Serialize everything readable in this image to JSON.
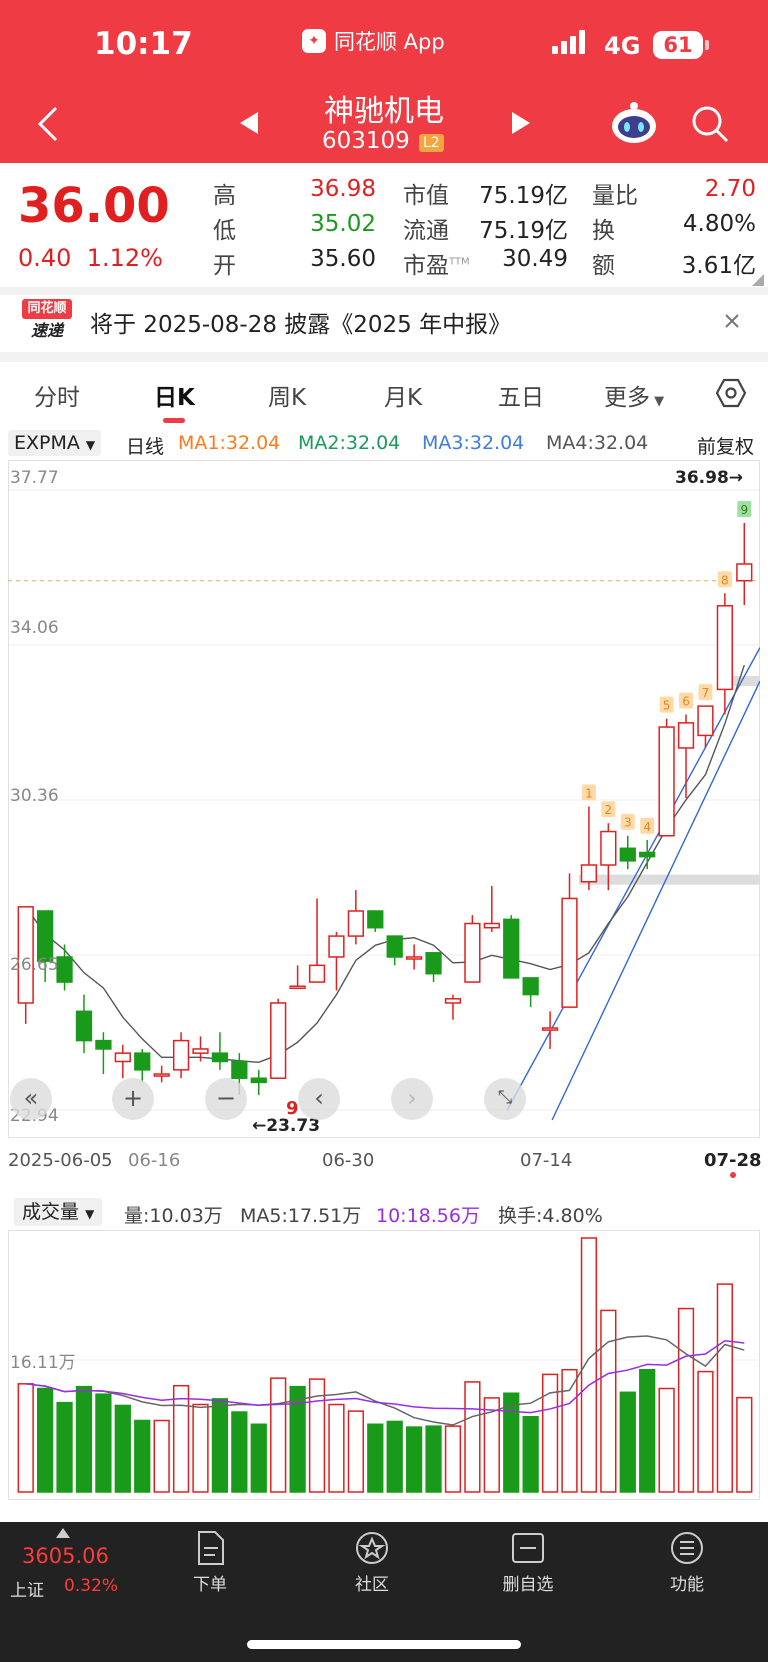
{
  "status": {
    "time": "10:17",
    "app": "同花顺 App",
    "network": "4G",
    "battery": "61"
  },
  "header": {
    "stock_name": "神驰机电",
    "stock_code": "603109",
    "level": "L2"
  },
  "quote": {
    "price": "36.00",
    "change": "0.40",
    "change_pct": "1.12%",
    "high_label": "高",
    "high": "36.98",
    "low_label": "低",
    "low": "35.02",
    "open_label": "开",
    "open": "35.60",
    "mktcap_label": "市值",
    "mktcap": "75.19亿",
    "float_label": "流通",
    "float": "75.19亿",
    "pe_label": "市盈",
    "pe_sup": "TTM",
    "pe": "30.49",
    "vr_label": "量比",
    "vr": "2.70",
    "turn_label": "换",
    "turn": "4.80%",
    "amt_label": "额",
    "amt": "3.61亿"
  },
  "notice": {
    "logo_top": "同花顺",
    "logo_bottom": "速递",
    "text": "将于 2025-08-28 披露《2025 年中报》"
  },
  "tabs": [
    "分时",
    "日K",
    "周K",
    "月K",
    "五日",
    "更多"
  ],
  "ma": {
    "indicator": "EXPMA",
    "period": "日线",
    "ma1": "MA1:32.04",
    "ma2": "MA2:32.04",
    "ma3": "MA3:32.04",
    "ma4": "MA4:32.04",
    "adjust": "前复权"
  },
  "price_axis": [
    "37.77",
    "34.06",
    "30.36",
    "26.65",
    "22.94"
  ],
  "annotations": {
    "high": "36.98→",
    "low": "←23.73",
    "low_mark": "9"
  },
  "dates": [
    "2025-06-05",
    "06-16",
    "06-30",
    "07-14",
    "07-28"
  ],
  "volume": {
    "indicator": "成交量",
    "vol": "量:10.03万",
    "ma5": "MA5:17.51万",
    "ma10": "10:18.56万",
    "turnover": "换手:4.80%",
    "axis": "16.11万"
  },
  "bottom_nav": {
    "index_value": "3605.06",
    "index_name": "上证",
    "index_pct": "0.32%",
    "items": [
      "下单",
      "社区",
      "删自选",
      "功能"
    ]
  },
  "colors": {
    "brand": "#ef3b44",
    "up": "#e02020",
    "down": "#1a9a1a"
  },
  "chart_data": {
    "type": "candlestick",
    "ylim": [
      22.94,
      37.77
    ],
    "candles": [
      {
        "o": 25.5,
        "c": 27.8,
        "h": 27.8,
        "l": 25.0
      },
      {
        "o": 27.7,
        "c": 26.5,
        "h": 27.7,
        "l": 26.0
      },
      {
        "o": 26.6,
        "c": 26.0,
        "h": 26.9,
        "l": 25.8
      },
      {
        "o": 25.3,
        "c": 24.6,
        "h": 25.7,
        "l": 24.3
      },
      {
        "o": 24.6,
        "c": 24.4,
        "h": 24.8,
        "l": 23.8
      },
      {
        "o": 24.1,
        "c": 24.3,
        "h": 24.5,
        "l": 23.7
      },
      {
        "o": 24.3,
        "c": 23.9,
        "h": 24.4,
        "l": 23.6
      },
      {
        "o": 23.8,
        "c": 23.8,
        "h": 24.0,
        "l": 23.6
      },
      {
        "o": 23.9,
        "c": 24.6,
        "h": 24.8,
        "l": 23.7
      },
      {
        "o": 24.3,
        "c": 24.4,
        "h": 24.7,
        "l": 24.1
      },
      {
        "o": 24.3,
        "c": 24.1,
        "h": 24.8,
        "l": 23.9
      },
      {
        "o": 24.1,
        "c": 23.7,
        "h": 24.3,
        "l": 23.3
      },
      {
        "o": 23.7,
        "c": 23.6,
        "h": 23.9,
        "l": 23.3
      },
      {
        "o": 23.7,
        "c": 25.5,
        "h": 25.6,
        "l": 23.73
      },
      {
        "o": 25.9,
        "c": 25.9,
        "h": 26.4,
        "l": 25.9
      },
      {
        "o": 26.0,
        "c": 26.4,
        "h": 28.0,
        "l": 26.0
      },
      {
        "o": 26.6,
        "c": 27.1,
        "h": 27.2,
        "l": 25.8
      },
      {
        "o": 27.1,
        "c": 27.7,
        "h": 28.2,
        "l": 26.9
      },
      {
        "o": 27.7,
        "c": 27.3,
        "h": 27.7,
        "l": 27.2
      },
      {
        "o": 27.1,
        "c": 26.6,
        "h": 27.1,
        "l": 26.4
      },
      {
        "o": 26.6,
        "c": 26.6,
        "h": 26.9,
        "l": 26.3
      },
      {
        "o": 26.7,
        "c": 26.2,
        "h": 26.7,
        "l": 26.0
      },
      {
        "o": 25.5,
        "c": 25.6,
        "h": 25.7,
        "l": 25.1
      },
      {
        "o": 26.0,
        "c": 27.4,
        "h": 27.6,
        "l": 26.0
      },
      {
        "o": 27.3,
        "c": 27.4,
        "h": 28.3,
        "l": 27.2
      },
      {
        "o": 27.5,
        "c": 26.1,
        "h": 27.6,
        "l": 26.1
      },
      {
        "o": 26.1,
        "c": 25.7,
        "h": 26.1,
        "l": 25.4
      },
      {
        "o": 24.9,
        "c": 24.9,
        "h": 25.3,
        "l": 24.4
      },
      {
        "o": 25.4,
        "c": 28.0,
        "h": 28.6,
        "l": 25.4
      },
      {
        "o": 28.4,
        "c": 28.8,
        "h": 30.2,
        "l": 28.2
      },
      {
        "o": 28.8,
        "c": 29.6,
        "h": 29.8,
        "l": 28.2
      },
      {
        "o": 29.2,
        "c": 28.9,
        "h": 29.5,
        "l": 28.7
      },
      {
        "o": 29.1,
        "c": 29.0,
        "h": 29.4,
        "l": 28.7
      },
      {
        "o": 29.5,
        "c": 32.1,
        "h": 32.3,
        "l": 29.5
      },
      {
        "o": 31.6,
        "c": 32.2,
        "h": 32.4,
        "l": 30.4
      },
      {
        "o": 31.9,
        "c": 32.6,
        "h": 32.6,
        "l": 31.6
      },
      {
        "o": 33.0,
        "c": 35.0,
        "h": 35.3,
        "l": 32.4
      },
      {
        "o": 35.6,
        "c": 36.0,
        "h": 36.98,
        "l": 35.02
      }
    ],
    "volume_max": 27.0,
    "volumes": [
      {
        "v": 11.5,
        "up": true
      },
      {
        "v": 11.0,
        "up": false
      },
      {
        "v": 9.5,
        "up": false
      },
      {
        "v": 11.2,
        "up": false
      },
      {
        "v": 10.4,
        "up": false
      },
      {
        "v": 9.2,
        "up": false
      },
      {
        "v": 7.6,
        "up": false
      },
      {
        "v": 7.6,
        "up": true
      },
      {
        "v": 11.3,
        "up": true
      },
      {
        "v": 9.3,
        "up": true
      },
      {
        "v": 9.9,
        "up": false
      },
      {
        "v": 8.5,
        "up": false
      },
      {
        "v": 7.2,
        "up": false
      },
      {
        "v": 12.1,
        "up": true
      },
      {
        "v": 11.2,
        "up": false
      },
      {
        "v": 12.0,
        "up": true
      },
      {
        "v": 9.3,
        "up": true
      },
      {
        "v": 8.6,
        "up": true
      },
      {
        "v": 7.2,
        "up": false
      },
      {
        "v": 7.5,
        "up": false
      },
      {
        "v": 6.9,
        "up": false
      },
      {
        "v": 7.0,
        "up": false
      },
      {
        "v": 7.0,
        "up": true
      },
      {
        "v": 11.7,
        "up": true
      },
      {
        "v": 10.0,
        "up": true
      },
      {
        "v": 10.5,
        "up": false
      },
      {
        "v": 8.0,
        "up": false
      },
      {
        "v": 12.5,
        "up": true
      },
      {
        "v": 13.0,
        "up": true
      },
      {
        "v": 27.0,
        "up": true
      },
      {
        "v": 19.3,
        "up": true
      },
      {
        "v": 10.6,
        "up": false
      },
      {
        "v": 13.0,
        "up": false
      },
      {
        "v": 11.0,
        "up": true
      },
      {
        "v": 19.5,
        "up": true
      },
      {
        "v": 12.8,
        "up": true
      },
      {
        "v": 22.1,
        "up": true
      },
      {
        "v": 10.03,
        "up": true
      }
    ],
    "seq_labels": [
      "1",
      "2",
      "3",
      "4",
      "5",
      "6",
      "7",
      "8",
      "9"
    ]
  }
}
